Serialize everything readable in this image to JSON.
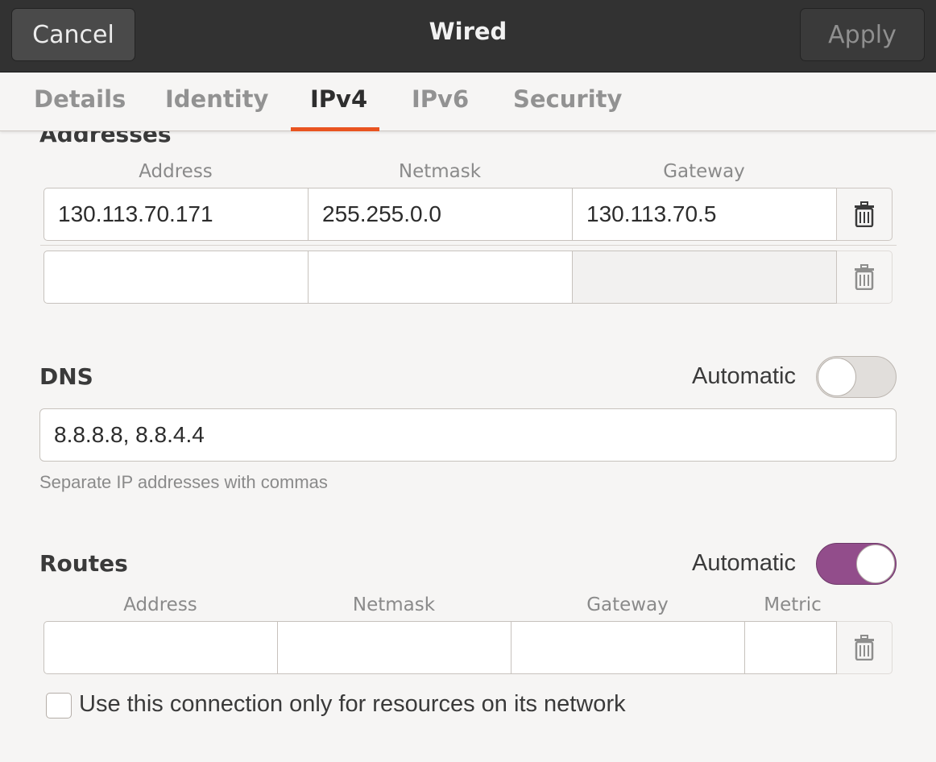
{
  "header": {
    "cancel_label": "Cancel",
    "title": "Wired",
    "apply_label": "Apply"
  },
  "tabs": [
    {
      "label": "Details"
    },
    {
      "label": "Identity"
    },
    {
      "label": "IPv4",
      "active": true
    },
    {
      "label": "IPv6"
    },
    {
      "label": "Security"
    }
  ],
  "addresses": {
    "title": "Addresses",
    "columns": [
      "Address",
      "Netmask",
      "Gateway"
    ],
    "rows": [
      {
        "address": "130.113.70.171",
        "netmask": "255.255.0.0",
        "gateway": "130.113.70.5"
      },
      {
        "address": "",
        "netmask": "",
        "gateway": ""
      }
    ]
  },
  "dns": {
    "title": "DNS",
    "automatic_label": "Automatic",
    "automatic": false,
    "value": "8.8.8.8, 8.8.4.4",
    "hint": "Separate IP addresses with commas"
  },
  "routes": {
    "title": "Routes",
    "automatic_label": "Automatic",
    "automatic": true,
    "columns": [
      "Address",
      "Netmask",
      "Gateway",
      "Metric"
    ],
    "rows": [
      {
        "address": "",
        "netmask": "",
        "gateway": "",
        "metric": ""
      }
    ]
  },
  "only_local": {
    "label": "Use this connection only for resources on its network",
    "checked": false
  },
  "colors": {
    "accent_tab": "#e95420",
    "switch_on": "#924d8b",
    "headerbar": "#323232"
  },
  "icons": {
    "delete": "trash-icon"
  }
}
